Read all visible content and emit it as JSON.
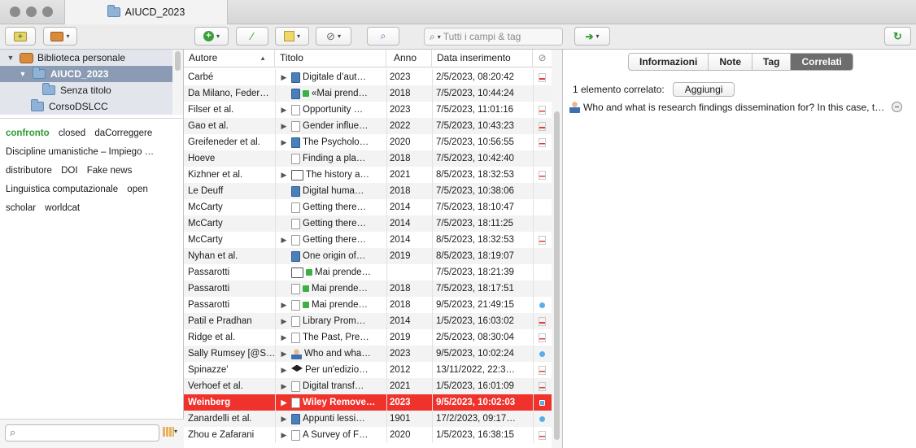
{
  "window": {
    "tab_title": "AIUCD_2023"
  },
  "toolbar": {
    "search_placeholder": "Tutti i campi & tag"
  },
  "collections": {
    "items": [
      {
        "label": "Biblioteca personale"
      },
      {
        "label": "AIUCD_2023"
      },
      {
        "label": "Senza titolo"
      },
      {
        "label": "CorsoDSLCC"
      }
    ]
  },
  "tags": [
    "confronto",
    "closed",
    "daCorreggere",
    "Discipline umanistiche – Impiego …",
    "distributore",
    "DOI",
    "Fake news",
    "Linguistica computazionale",
    "open",
    "scholar",
    "worldcat"
  ],
  "table": {
    "headers": {
      "author": "Autore",
      "title": "Titolo",
      "year": "Anno",
      "date": "Data inserimento"
    },
    "rows": [
      {
        "author": "Carbé",
        "title": "Digitale d’aut…",
        "year": "2023",
        "date": "2/5/2023, 08:20:42",
        "icon": "book",
        "expand": true,
        "green": false,
        "att": "pdf"
      },
      {
        "author": "Da Milano, Feder…",
        "title": "«Mai prend…",
        "year": "2018",
        "date": "7/5/2023, 10:44:24",
        "icon": "book",
        "expand": false,
        "green": true,
        "att": ""
      },
      {
        "author": "Filser et al.",
        "title": "Opportunity …",
        "year": "2023",
        "date": "7/5/2023, 11:01:16",
        "icon": "doc",
        "expand": true,
        "green": false,
        "att": "pdf"
      },
      {
        "author": "Gao et al.",
        "title": "Gender influe…",
        "year": "2022",
        "date": "7/5/2023, 10:43:23",
        "icon": "doc",
        "expand": true,
        "green": false,
        "att": "pdf"
      },
      {
        "author": "Greifeneder et al.",
        "title": "The Psycholo…",
        "year": "2020",
        "date": "7/5/2023, 10:56:55",
        "icon": "book",
        "expand": true,
        "green": false,
        "att": "pdf"
      },
      {
        "author": "Hoeve",
        "title": "Finding a pla…",
        "year": "2018",
        "date": "7/5/2023, 10:42:40",
        "icon": "doc",
        "expand": false,
        "green": false,
        "att": ""
      },
      {
        "author": "Kizhner et al.",
        "title": "The history a…",
        "year": "2021",
        "date": "8/5/2023, 18:32:53",
        "icon": "obook",
        "expand": true,
        "green": false,
        "att": "pdf"
      },
      {
        "author": "Le Deuff",
        "title": "Digital huma…",
        "year": "2018",
        "date": "7/5/2023, 10:38:06",
        "icon": "book",
        "expand": false,
        "green": false,
        "att": ""
      },
      {
        "author": "McCarty",
        "title": "Getting there…",
        "year": "2014",
        "date": "7/5/2023, 18:10:47",
        "icon": "doc",
        "expand": false,
        "green": false,
        "att": ""
      },
      {
        "author": "McCarty",
        "title": "Getting there…",
        "year": "2014",
        "date": "7/5/2023, 18:11:25",
        "icon": "doc",
        "expand": false,
        "green": false,
        "att": ""
      },
      {
        "author": "McCarty",
        "title": "Getting there…",
        "year": "2014",
        "date": "8/5/2023, 18:32:53",
        "icon": "doc",
        "expand": true,
        "green": false,
        "att": "pdf"
      },
      {
        "author": "Nyhan et al.",
        "title": "One origin of…",
        "year": "2019",
        "date": "8/5/2023, 18:19:07",
        "icon": "book",
        "expand": false,
        "green": false,
        "att": ""
      },
      {
        "author": "Passarotti",
        "title": "Mai prende…",
        "year": "",
        "date": "7/5/2023, 18:21:39",
        "icon": "obook",
        "expand": false,
        "green": true,
        "att": ""
      },
      {
        "author": "Passarotti",
        "title": "Mai prende…",
        "year": "2018",
        "date": "7/5/2023, 18:17:51",
        "icon": "doc",
        "expand": false,
        "green": true,
        "att": ""
      },
      {
        "author": "Passarotti",
        "title": "Mai prende…",
        "year": "2018",
        "date": "9/5/2023, 21:49:15",
        "icon": "doc",
        "expand": true,
        "green": true,
        "att": "snap"
      },
      {
        "author": "Patil e Pradhan",
        "title": "Library Prom…",
        "year": "2014",
        "date": "1/5/2023, 16:03:02",
        "icon": "doc",
        "expand": true,
        "green": false,
        "att": "pdf"
      },
      {
        "author": "Ridge et al.",
        "title": "The Past, Pre…",
        "year": "2019",
        "date": "2/5/2023, 08:30:04",
        "icon": "doc",
        "expand": true,
        "green": false,
        "att": "pdf"
      },
      {
        "author": "Sally Rumsey [@S…",
        "title": "Who and wha…",
        "year": "2023",
        "date": "9/5/2023, 10:02:24",
        "icon": "person",
        "expand": true,
        "green": false,
        "att": "snap"
      },
      {
        "author": "Spinazze'",
        "title": "Per un'edizio…",
        "year": "2012",
        "date": "13/11/2022, 22:3…",
        "icon": "grad",
        "expand": true,
        "green": false,
        "att": "pdf"
      },
      {
        "author": "Verhoef et al.",
        "title": "Digital transf…",
        "year": "2021",
        "date": "1/5/2023, 16:01:09",
        "icon": "doc",
        "expand": true,
        "green": false,
        "att": "pdf"
      },
      {
        "author": "Weinberg",
        "title": "Wiley Remove…",
        "year": "2023",
        "date": "9/5/2023, 10:02:03",
        "icon": "doc",
        "expand": true,
        "green": false,
        "att": "snap",
        "selected": true
      },
      {
        "author": "Zanardelli et al.",
        "title": "Appunti lessi…",
        "year": "1901",
        "date": "17/2/2023, 09:17…",
        "icon": "book",
        "expand": true,
        "green": false,
        "att": "snap"
      },
      {
        "author": "Zhou e Zafarani",
        "title": "A Survey of F…",
        "year": "2020",
        "date": "1/5/2023, 16:38:15",
        "icon": "doc",
        "expand": true,
        "green": false,
        "att": "pdf"
      }
    ]
  },
  "item_pane": {
    "tabs": [
      "Informazioni",
      "Note",
      "Tag",
      "Correlati"
    ],
    "active_tab": "Correlati",
    "related_count": "1 elemento correlato:",
    "add_label": "Aggiungi",
    "related_items": [
      "Who and what is research findings dissemination for? In this case, the publication of research results in peer reviewed journals"
    ]
  }
}
